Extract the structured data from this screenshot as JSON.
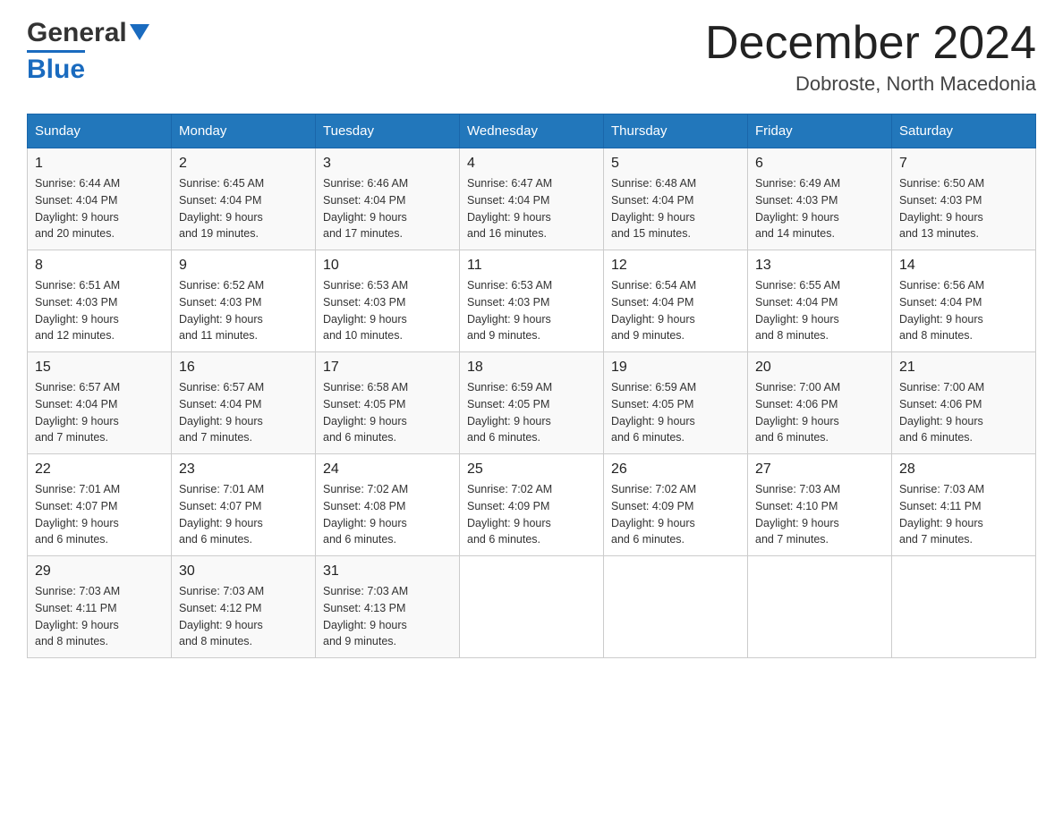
{
  "header": {
    "logo_general": "General",
    "logo_blue": "Blue",
    "title": "December 2024",
    "subtitle": "Dobroste, North Macedonia"
  },
  "days_of_week": [
    "Sunday",
    "Monday",
    "Tuesday",
    "Wednesday",
    "Thursday",
    "Friday",
    "Saturday"
  ],
  "weeks": [
    [
      {
        "day": "1",
        "sunrise": "6:44 AM",
        "sunset": "4:04 PM",
        "daylight": "9 hours and 20 minutes."
      },
      {
        "day": "2",
        "sunrise": "6:45 AM",
        "sunset": "4:04 PM",
        "daylight": "9 hours and 19 minutes."
      },
      {
        "day": "3",
        "sunrise": "6:46 AM",
        "sunset": "4:04 PM",
        "daylight": "9 hours and 17 minutes."
      },
      {
        "day": "4",
        "sunrise": "6:47 AM",
        "sunset": "4:04 PM",
        "daylight": "9 hours and 16 minutes."
      },
      {
        "day": "5",
        "sunrise": "6:48 AM",
        "sunset": "4:04 PM",
        "daylight": "9 hours and 15 minutes."
      },
      {
        "day": "6",
        "sunrise": "6:49 AM",
        "sunset": "4:03 PM",
        "daylight": "9 hours and 14 minutes."
      },
      {
        "day": "7",
        "sunrise": "6:50 AM",
        "sunset": "4:03 PM",
        "daylight": "9 hours and 13 minutes."
      }
    ],
    [
      {
        "day": "8",
        "sunrise": "6:51 AM",
        "sunset": "4:03 PM",
        "daylight": "9 hours and 12 minutes."
      },
      {
        "day": "9",
        "sunrise": "6:52 AM",
        "sunset": "4:03 PM",
        "daylight": "9 hours and 11 minutes."
      },
      {
        "day": "10",
        "sunrise": "6:53 AM",
        "sunset": "4:03 PM",
        "daylight": "9 hours and 10 minutes."
      },
      {
        "day": "11",
        "sunrise": "6:53 AM",
        "sunset": "4:03 PM",
        "daylight": "9 hours and 9 minutes."
      },
      {
        "day": "12",
        "sunrise": "6:54 AM",
        "sunset": "4:04 PM",
        "daylight": "9 hours and 9 minutes."
      },
      {
        "day": "13",
        "sunrise": "6:55 AM",
        "sunset": "4:04 PM",
        "daylight": "9 hours and 8 minutes."
      },
      {
        "day": "14",
        "sunrise": "6:56 AM",
        "sunset": "4:04 PM",
        "daylight": "9 hours and 8 minutes."
      }
    ],
    [
      {
        "day": "15",
        "sunrise": "6:57 AM",
        "sunset": "4:04 PM",
        "daylight": "9 hours and 7 minutes."
      },
      {
        "day": "16",
        "sunrise": "6:57 AM",
        "sunset": "4:04 PM",
        "daylight": "9 hours and 7 minutes."
      },
      {
        "day": "17",
        "sunrise": "6:58 AM",
        "sunset": "4:05 PM",
        "daylight": "9 hours and 6 minutes."
      },
      {
        "day": "18",
        "sunrise": "6:59 AM",
        "sunset": "4:05 PM",
        "daylight": "9 hours and 6 minutes."
      },
      {
        "day": "19",
        "sunrise": "6:59 AM",
        "sunset": "4:05 PM",
        "daylight": "9 hours and 6 minutes."
      },
      {
        "day": "20",
        "sunrise": "7:00 AM",
        "sunset": "4:06 PM",
        "daylight": "9 hours and 6 minutes."
      },
      {
        "day": "21",
        "sunrise": "7:00 AM",
        "sunset": "4:06 PM",
        "daylight": "9 hours and 6 minutes."
      }
    ],
    [
      {
        "day": "22",
        "sunrise": "7:01 AM",
        "sunset": "4:07 PM",
        "daylight": "9 hours and 6 minutes."
      },
      {
        "day": "23",
        "sunrise": "7:01 AM",
        "sunset": "4:07 PM",
        "daylight": "9 hours and 6 minutes."
      },
      {
        "day": "24",
        "sunrise": "7:02 AM",
        "sunset": "4:08 PM",
        "daylight": "9 hours and 6 minutes."
      },
      {
        "day": "25",
        "sunrise": "7:02 AM",
        "sunset": "4:09 PM",
        "daylight": "9 hours and 6 minutes."
      },
      {
        "day": "26",
        "sunrise": "7:02 AM",
        "sunset": "4:09 PM",
        "daylight": "9 hours and 6 minutes."
      },
      {
        "day": "27",
        "sunrise": "7:03 AM",
        "sunset": "4:10 PM",
        "daylight": "9 hours and 7 minutes."
      },
      {
        "day": "28",
        "sunrise": "7:03 AM",
        "sunset": "4:11 PM",
        "daylight": "9 hours and 7 minutes."
      }
    ],
    [
      {
        "day": "29",
        "sunrise": "7:03 AM",
        "sunset": "4:11 PM",
        "daylight": "9 hours and 8 minutes."
      },
      {
        "day": "30",
        "sunrise": "7:03 AM",
        "sunset": "4:12 PM",
        "daylight": "9 hours and 8 minutes."
      },
      {
        "day": "31",
        "sunrise": "7:03 AM",
        "sunset": "4:13 PM",
        "daylight": "9 hours and 9 minutes."
      },
      null,
      null,
      null,
      null
    ]
  ],
  "labels": {
    "sunrise": "Sunrise:",
    "sunset": "Sunset:",
    "daylight": "Daylight:"
  }
}
